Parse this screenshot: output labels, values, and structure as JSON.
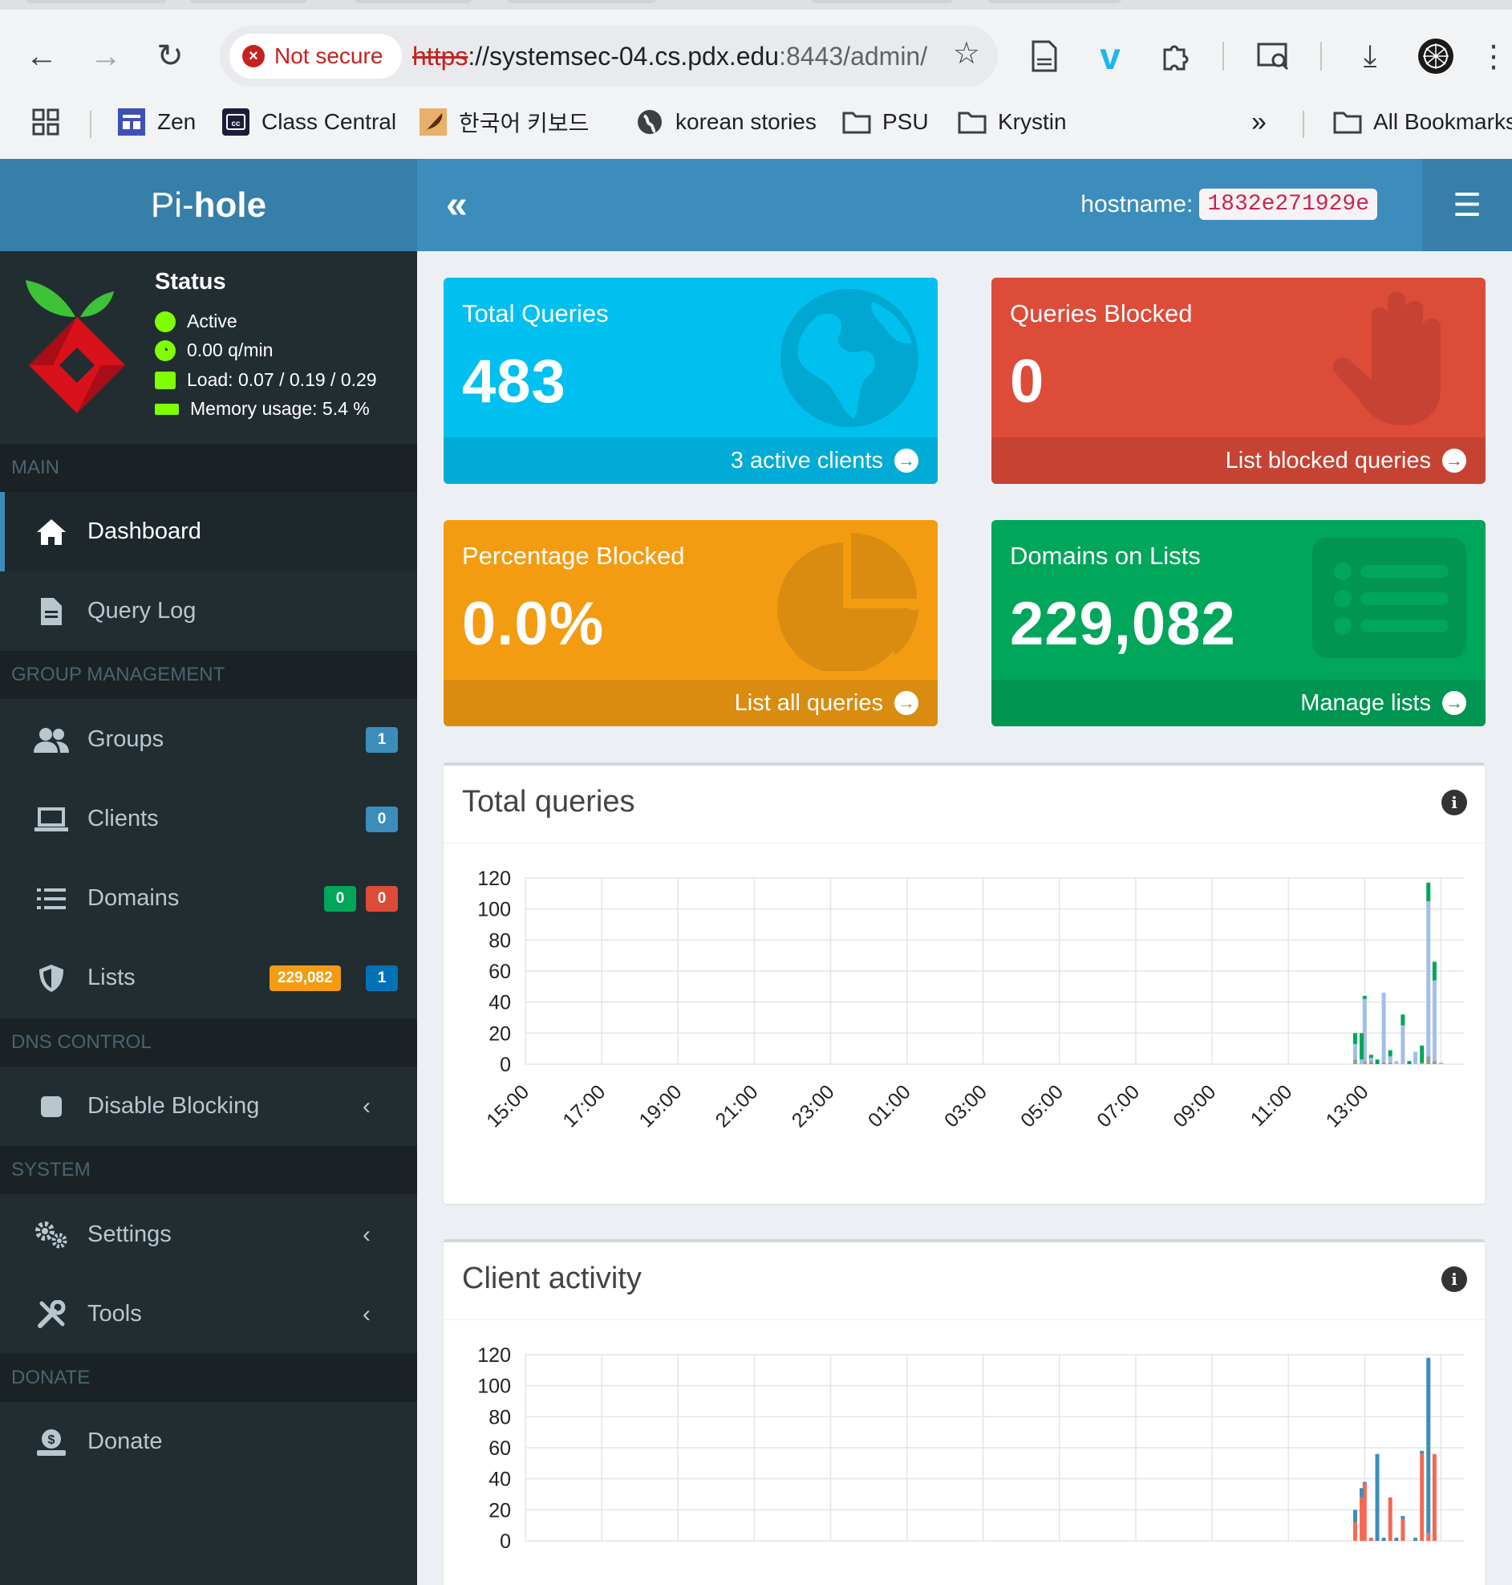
{
  "browser": {
    "security_label": "Not secure",
    "url_scheme": "https",
    "url_rest": "://systemsec-04.cs.pdx.edu",
    "url_path": ":8443/admin/",
    "bookmarks": [
      {
        "label": "Zen",
        "icon": "zen-icon"
      },
      {
        "label": "Class Central",
        "icon": "class-central-icon"
      },
      {
        "label": "한국어 키보드",
        "icon": "feather-icon"
      },
      {
        "label": "korean stories",
        "icon": "globe-icon"
      },
      {
        "label": "PSU",
        "icon": "folder-icon"
      },
      {
        "label": "Krystin",
        "icon": "folder-icon"
      }
    ],
    "more": "»",
    "all_bookmarks": "All Bookmarks"
  },
  "header": {
    "brand_pre": "Pi-",
    "brand_bold": "hole",
    "toggle": "«",
    "hostname_label": "hostname:",
    "hostname_value": "1832e271929e",
    "menu": "☰"
  },
  "sidebar": {
    "status_title": "Status",
    "status_active": "Active",
    "status_qpm": "0.00 q/min",
    "status_load": "Load: 0.07 / 0.19 / 0.29",
    "status_memory": "Memory usage: 5.4 %",
    "sections": {
      "main": "MAIN",
      "group": "GROUP MANAGEMENT",
      "dns": "DNS CONTROL",
      "system": "SYSTEM",
      "donate": "DONATE"
    },
    "items": {
      "dashboard": "Dashboard",
      "querylog": "Query Log",
      "groups": "Groups",
      "groups_badge": "1",
      "clients": "Clients",
      "clients_badge": "0",
      "domains": "Domains",
      "domains_badge_allow": "0",
      "domains_badge_deny": "0",
      "lists": "Lists",
      "lists_badge_domains": "229,082",
      "lists_badge_count": "1",
      "disable": "Disable Blocking",
      "settings": "Settings",
      "tools": "Tools",
      "donate": "Donate"
    },
    "colors": {
      "bg": "#222d32",
      "accent": "#3c8dbc",
      "status_green": "#7fff00"
    }
  },
  "stats": {
    "total_queries": {
      "title": "Total Queries",
      "value": "483",
      "footer": "3 active clients"
    },
    "queries_blocked": {
      "title": "Queries Blocked",
      "value": "0",
      "footer": "List blocked queries"
    },
    "percent_blocked": {
      "title": "Percentage Blocked",
      "value": "0.0%",
      "footer": "List all queries"
    },
    "domains_on_lists": {
      "title": "Domains on Lists",
      "value": "229,082",
      "footer": "Manage lists"
    }
  },
  "panels": {
    "total_queries_title": "Total queries",
    "client_activity_title": "Client activity",
    "info": "i"
  },
  "chart_data": [
    {
      "type": "bar",
      "title": "Total queries",
      "ylim": [
        0,
        120
      ],
      "yticks": [
        0,
        20,
        40,
        60,
        80,
        100,
        120
      ],
      "xtick_labels": [
        "15:00",
        "17:00",
        "19:00",
        "21:00",
        "23:00",
        "01:00",
        "03:00",
        "05:00",
        "07:00",
        "09:00",
        "11:00",
        "13:00"
      ],
      "grid": true,
      "x_start_hour": 15,
      "x_end_hour": 39.6,
      "stacked": true,
      "series": [
        {
          "color": "#999999",
          "x": [
            12.75,
            13.0,
            13.17,
            13.5,
            13.67,
            14.5,
            14.67,
            14.83
          ],
          "values": [
            3,
            2,
            2,
            1,
            1,
            1,
            5,
            2
          ]
        },
        {
          "color": "#a0bfe8",
          "x": [
            12.75,
            12.92,
            13.0,
            13.17,
            13.5,
            13.67,
            13.83,
            14.0,
            14.33,
            14.5,
            14.67,
            14.83,
            15.0
          ],
          "values": [
            10,
            3,
            40,
            2,
            45,
            4,
            2,
            25,
            8,
            0,
            100,
            52,
            1
          ]
        },
        {
          "color": "#00a65a",
          "x": [
            12.75,
            12.92,
            13.0,
            13.17,
            13.33,
            13.67,
            14.0,
            14.17,
            14.5,
            14.67,
            14.83
          ],
          "values": [
            7,
            17,
            2,
            2,
            3,
            4,
            7,
            2,
            11,
            12,
            12
          ]
        }
      ]
    },
    {
      "type": "bar",
      "title": "Client activity",
      "ylim": [
        0,
        120
      ],
      "yticks": [
        0,
        20,
        40,
        60,
        80,
        100,
        120
      ],
      "grid": true,
      "x_start_hour": 15,
      "x_end_hour": 39.6,
      "stacked": true,
      "series": [
        {
          "color": "#f56954",
          "x": [
            12.75,
            12.92,
            13.0,
            13.17,
            13.67,
            14.0,
            14.5,
            14.67,
            14.83
          ],
          "values": [
            12,
            28,
            37,
            2,
            28,
            14,
            56,
            5,
            56
          ]
        },
        {
          "color": "#3c8dbc",
          "x": [
            12.75,
            12.92,
            13.0,
            13.33,
            13.5,
            13.83,
            14.0,
            14.33,
            14.5,
            14.67
          ],
          "values": [
            8,
            6,
            1,
            56,
            2,
            2,
            2,
            2,
            2,
            113
          ]
        }
      ]
    }
  ]
}
